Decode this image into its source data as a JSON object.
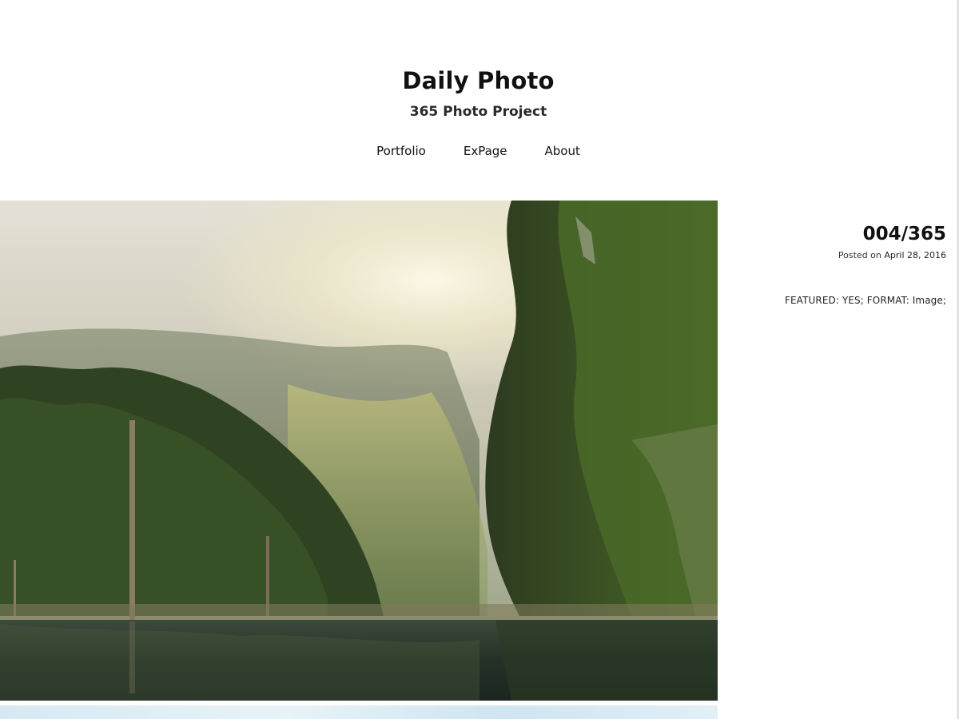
{
  "header": {
    "title": "Daily Photo",
    "tagline": "365 Photo Project"
  },
  "nav": {
    "items": [
      {
        "label": "Portfolio"
      },
      {
        "label": "ExPage"
      },
      {
        "label": "About"
      }
    ]
  },
  "post": {
    "title": "004/365",
    "posted_prefix": "Posted on",
    "date": "April 28, 2016",
    "meta_line": "FEATURED: YES; FORMAT: Image;"
  },
  "colors": {
    "text": "#111111",
    "background": "#ffffff"
  }
}
